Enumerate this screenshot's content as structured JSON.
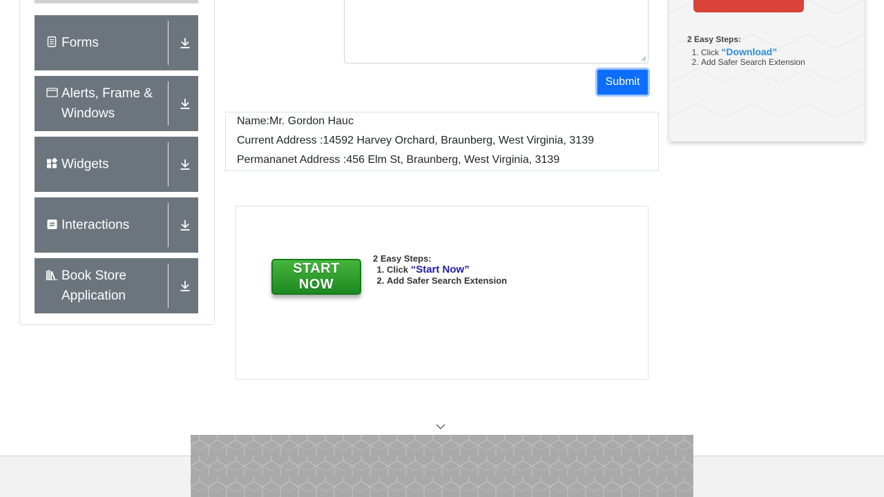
{
  "sidebar": {
    "groups": [
      {
        "label": "Forms",
        "icon": "form-icon"
      },
      {
        "label": "Alerts, Frame & Windows",
        "icon": "window-icon"
      },
      {
        "label": "Widgets",
        "icon": "widgets-icon"
      },
      {
        "label": "Interactions",
        "icon": "interactions-icon"
      },
      {
        "label": "Book Store Application",
        "icon": "book-icon"
      }
    ]
  },
  "form": {
    "submit_label": "Submit"
  },
  "output": {
    "name": "Name:Mr. Gordon Hauc",
    "current_address": "Current Address :14592 Harvey Orchard, Braunberg, West Virginia, 3139",
    "permanent_address": "Permananet Address :456 Elm St, Braunberg, West Virginia, 3139"
  },
  "center_ad": {
    "button_line1": "START",
    "button_line2": "NOW",
    "steps_title": "2 Easy Steps:",
    "step1_prefix": "Click ",
    "step1_highlight": "“Start Now”",
    "step2": "Add Safer Search Extension"
  },
  "right_ad": {
    "steps_title": "2 Easy Steps:",
    "step1_prefix": "Click ",
    "step1_highlight": "“Download”",
    "step2": "Add Safer Search Extension"
  },
  "colors": {
    "sidebar_header": "#6c757d",
    "submit": "#0d6efd",
    "start_button": "#2e9e2a",
    "download_highlight": "#2a8ee0",
    "red_button": "#d9433a"
  }
}
